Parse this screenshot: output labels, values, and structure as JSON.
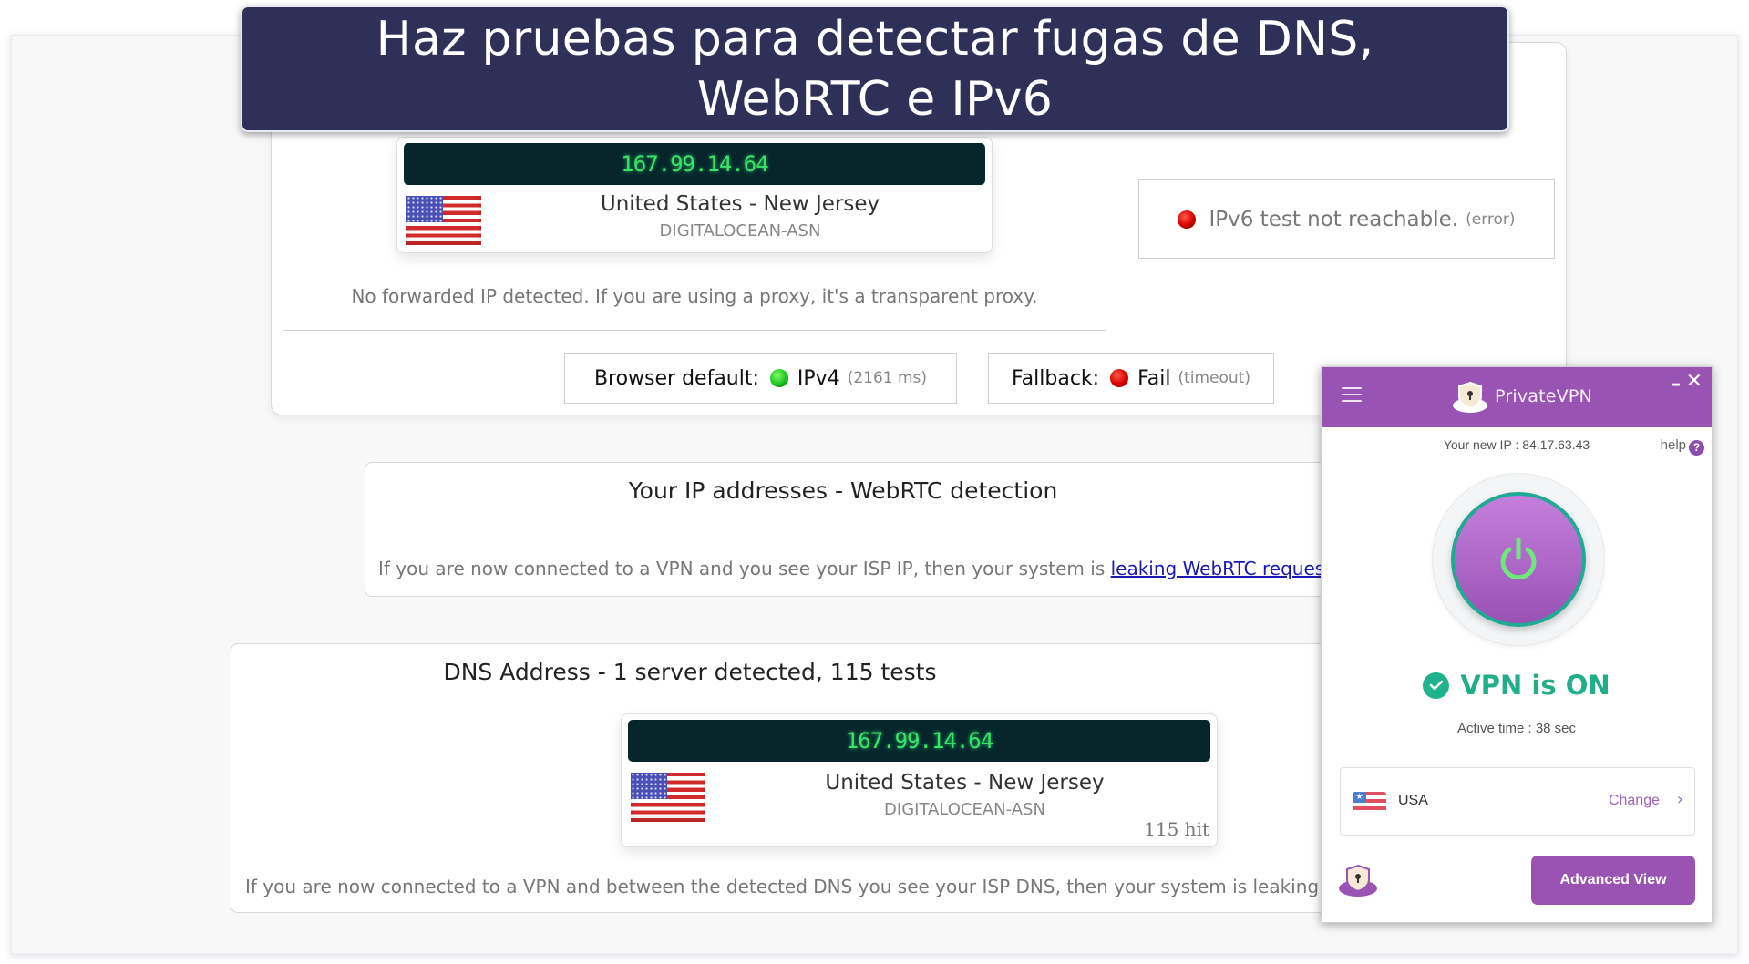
{
  "banner": {
    "title": "Haz pruebas para detectar fugas de DNS, WebRTC e IPv6"
  },
  "ip_test": {
    "ip": "167.99.14.64",
    "location": "United States - New Jersey",
    "asn": "DIGITALOCEAN-ASN",
    "forwarded_note": "No forwarded IP detected. If you are using a proxy, it's a transparent proxy."
  },
  "ipv6": {
    "status_color": "red",
    "message": "IPv6 test not reachable.",
    "detail": "(error)"
  },
  "connectivity": {
    "browser_default_label": "Browser default:",
    "browser_default_value": "IPv4",
    "browser_default_detail": "(2161 ms)",
    "browser_default_color": "green",
    "fallback_label": "Fallback:",
    "fallback_value": "Fail",
    "fallback_detail": "(timeout)",
    "fallback_color": "red"
  },
  "webrtc": {
    "title": "Your IP addresses - WebRTC detection",
    "note_prefix": "If you are now connected to a VPN and you see your ISP IP, then your system is ",
    "note_link": "leaking WebRTC requests"
  },
  "dns": {
    "title": "DNS Address - 1 server detected, 115 tests",
    "ip": "167.99.14.64",
    "location": "United States - New Jersey",
    "asn": "DIGITALOCEAN-ASN",
    "hits": "115 hit",
    "note": "If you are now connected to a VPN and between the detected DNS you see your ISP DNS, then your system is leaking DNS requests"
  },
  "vpn_app": {
    "app_name": "PrivateVPN",
    "menu_icon": "hamburger-icon",
    "minimize_label": "–",
    "close_label": "✕",
    "new_ip_label": "Your new IP : 84.17.63.43",
    "help_label": "help",
    "help_icon_glyph": "?",
    "status": "VPN is ON",
    "active_time": "Active time :  38 sec",
    "country": "USA",
    "change_label": "Change",
    "change_chevron": "›",
    "advanced_view_label": "Advanced View",
    "colors": {
      "brand": "#9954b3",
      "status_on": "#20ae8b",
      "ring": "#22a995",
      "power_glyph": "#6ee87a"
    }
  }
}
